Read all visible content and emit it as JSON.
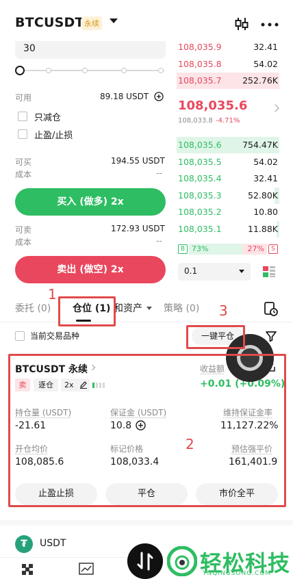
{
  "header": {
    "symbol": "BTCUSDT",
    "contract_tag": "永续",
    "icons": [
      "candlestick-icon",
      "more-icon"
    ]
  },
  "order_form": {
    "amount_value": "30",
    "slider_level": 0,
    "available_label": "可用",
    "available_value": "89.18 USDT",
    "reduce_only_label": "只减仓",
    "tp_sl_label": "止盈/止损",
    "buy_max_label": "可买",
    "buy_max_value": "194.55 USDT",
    "buy_cost_label": "成本",
    "buy_cost_value": "--",
    "buy_button": "买入 (做多) 2x",
    "sell_max_label": "可卖",
    "sell_max_value": "172.93 USDT",
    "sell_cost_label": "成本",
    "sell_cost_value": "--",
    "sell_button": "卖出 (做空) 2x"
  },
  "orderbook": {
    "asks": [
      {
        "price": "108,035.9",
        "qty": "32.41",
        "depth": 0
      },
      {
        "price": "108,035.8",
        "qty": "54.02",
        "depth": 0
      },
      {
        "price": "108,035.7",
        "qty": "252.76K",
        "depth": 1.0
      }
    ],
    "last_price": "108,035.6",
    "mark_price": "108,033.8",
    "change": "-4.71%",
    "bids": [
      {
        "price": "108,035.6",
        "qty": "754.47K",
        "depth": 1.0
      },
      {
        "price": "108,035.5",
        "qty": "54.02",
        "depth": 0
      },
      {
        "price": "108,035.4",
        "qty": "32.41",
        "depth": 0
      },
      {
        "price": "108,035.3",
        "qty": "52.80K",
        "depth": 0.05
      },
      {
        "price": "108,035.2",
        "qty": "10.80",
        "depth": 0
      },
      {
        "price": "108,035.1",
        "qty": "11.88K",
        "depth": 0.03
      }
    ],
    "buy_tag": "B",
    "buy_ratio": "73%",
    "sell_ratio": "27%",
    "sell_tag": "S",
    "precision": "0.1",
    "colors": {
      "up": "#2ebd62",
      "down": "#e8475d"
    }
  },
  "tabs": {
    "orders": "委托 (0)",
    "positions": "仓位 (1)",
    "assets": "和资产",
    "strategy": "策略 (0)"
  },
  "filter": {
    "current_only_label": "当前交易品种",
    "close_all_button": "一键平仓"
  },
  "position": {
    "symbol": "BTCUSDT 永续",
    "side_tag": "卖",
    "margin_mode": "逐仓",
    "leverage": "2x",
    "pnl_label": "收益额",
    "pnl_value": "+0.01 (+0.09%)",
    "size_label": "持仓量 (USDT)",
    "size_value": "-21.61",
    "margin_label": "保证金 (USDT)",
    "margin_value": "10.8",
    "mmr_label": "维持保证金率",
    "mmr_value": "11,127.22%",
    "entry_label": "开仓均价",
    "entry_value": "108,085.6",
    "mark_label": "标记价格",
    "mark_value": "108,033.4",
    "liq_label": "预估强平价",
    "liq_value": "161,401.9",
    "btn_tpsl": "止盈止损",
    "btn_close": "平仓",
    "btn_market_close": "市价全平"
  },
  "assets_section": {
    "coin": "USDT",
    "logo_letter": "₮"
  },
  "annotations": {
    "n1": "1",
    "n2": "2",
    "n3": "3",
    "color": "#e04a4a"
  },
  "watermark": {
    "text": "轻松科技",
    "sub": "YNQINGSONG.COM"
  }
}
